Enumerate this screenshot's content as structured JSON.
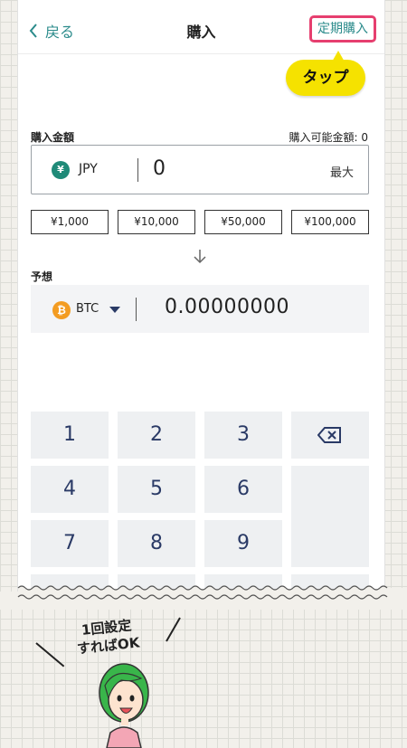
{
  "header": {
    "back_label": "戻る",
    "title": "購入",
    "scheduled_label": "定期購入"
  },
  "callout": {
    "tap_label": "タップ"
  },
  "purchase": {
    "amount_label": "購入金額",
    "available_label": "購入可能金額: 0",
    "currency_icon": "¥",
    "currency": "JPY",
    "amount_value": "0",
    "max_label": "最大",
    "presets": [
      "¥1,000",
      "¥10,000",
      "¥50,000",
      "¥100,000"
    ]
  },
  "estimate": {
    "label": "予想",
    "coin_icon": "₿",
    "coin": "BTC",
    "value": "0.00000000"
  },
  "keypad": {
    "keys": [
      "1",
      "2",
      "3",
      "4",
      "5",
      "6",
      "7",
      "8",
      "9"
    ]
  },
  "annotation": {
    "line1": "1回設定",
    "line2": "すればOK"
  },
  "colors": {
    "accent_teal": "#2b8b8b",
    "highlight_pink": "#e63f6f",
    "callout_yellow": "#f5e200",
    "jpy_green": "#1f8a78",
    "btc_orange": "#f39c22"
  }
}
